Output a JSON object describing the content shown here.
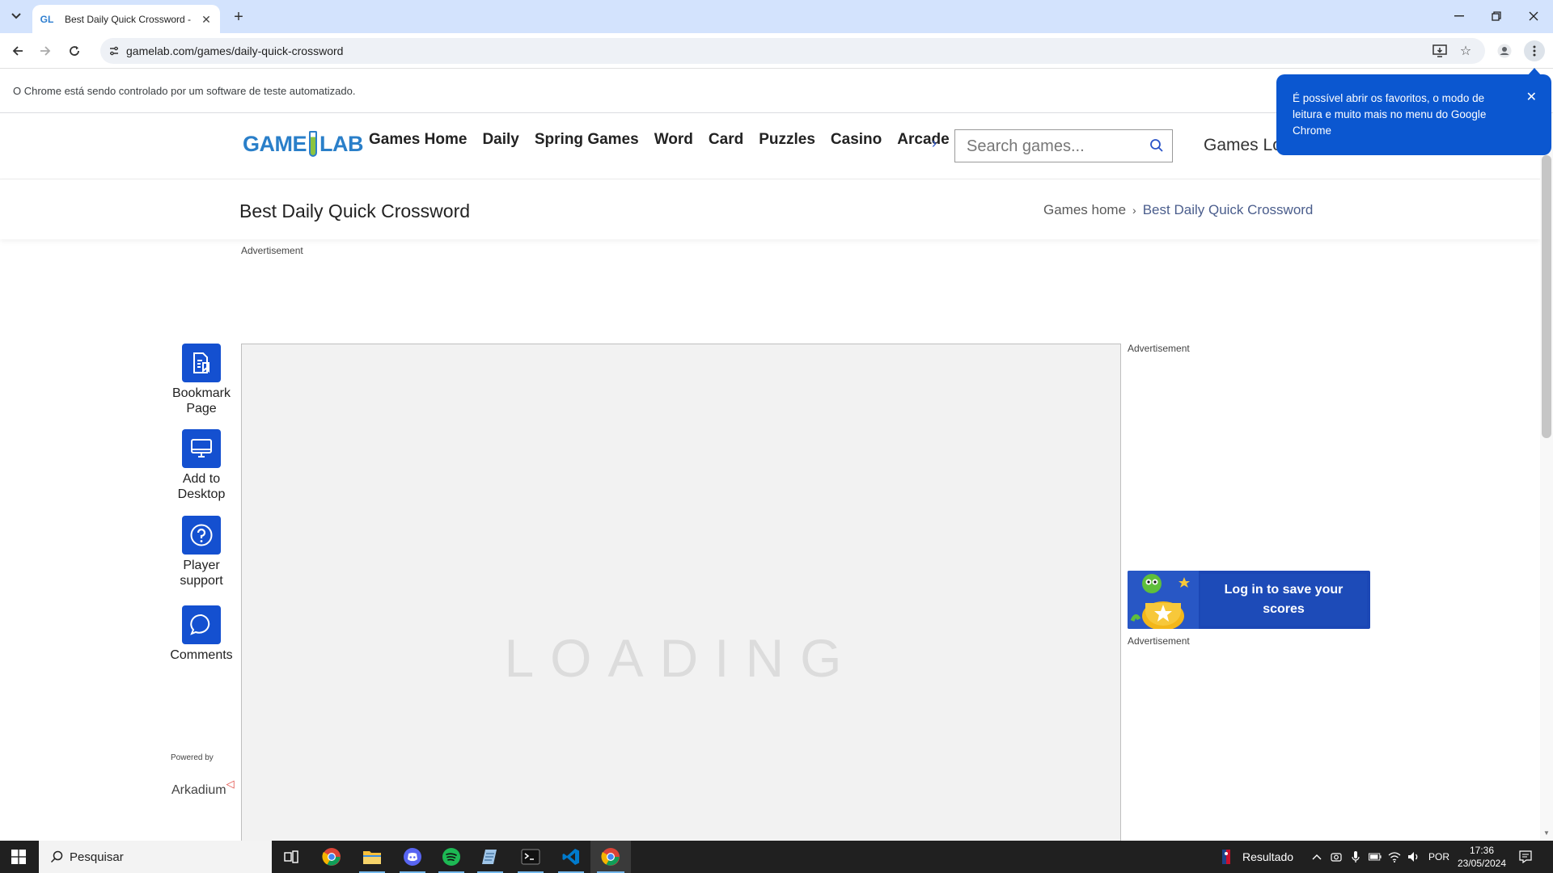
{
  "browser": {
    "tab_title": "Best Daily Quick Crossword - Fr",
    "tab_favicon": "GL",
    "url": "gamelab.com/games/daily-quick-crossword",
    "infobar_text": "O Chrome está sendo controlado por um software de teste automatizado.",
    "popup_text": "É possível abrir os favoritos, o modo de leitura e muito mais no menu do Google Chrome",
    "icons": [
      "tab-list-icon",
      "close-icon",
      "new-tab-icon",
      "minimize-icon",
      "restore-icon",
      "back-icon",
      "forward-icon",
      "reload-icon",
      "site-info-icon",
      "install-icon",
      "star-icon",
      "profile-icon",
      "menu-icon"
    ]
  },
  "site": {
    "logo_left": "GAME",
    "logo_right": "LAB",
    "nav": [
      "Games Home",
      "Daily",
      "Spring Games",
      "Word",
      "Card",
      "Puzzles",
      "Casino",
      "Arcade"
    ],
    "search_placeholder": "Search games...",
    "login_text": "Games Log",
    "page_title": "Best Daily Quick Crossword",
    "breadcrumb": {
      "home": "Games home",
      "current": "Best Daily Quick Crossword"
    },
    "ad_label": "Advertisement",
    "actions": [
      {
        "label_1": "Bookmark",
        "label_2": "Page"
      },
      {
        "label_1": "Add to",
        "label_2": "Desktop"
      },
      {
        "label_1": "Player",
        "label_2": "support"
      },
      {
        "label_1": "Comments",
        "label_2": ""
      }
    ],
    "powered_by": "Powered by",
    "powered_brand": "Arkadium",
    "loading_text": "LOADING",
    "login_banner_line1": "Log in to save your",
    "login_banner_line2": "scores"
  },
  "taskbar": {
    "search_placeholder": "Pesquisar",
    "apps": [
      "task-view-icon",
      "chrome-icon",
      "file-explorer-icon",
      "discord-icon",
      "spotify-icon",
      "notepad-icon",
      "terminal-icon",
      "vscode-icon",
      "chrome-active-icon"
    ],
    "news_text": "Resultado",
    "language": "POR",
    "time": "17:36",
    "date": "23/05/2024"
  },
  "colors": {
    "accent": "#1450d0",
    "tabbar": "#d3e3fd",
    "popup": "#0b57d0",
    "logo_blue": "#2a7fc9",
    "logo_green": "#8bc43f"
  }
}
